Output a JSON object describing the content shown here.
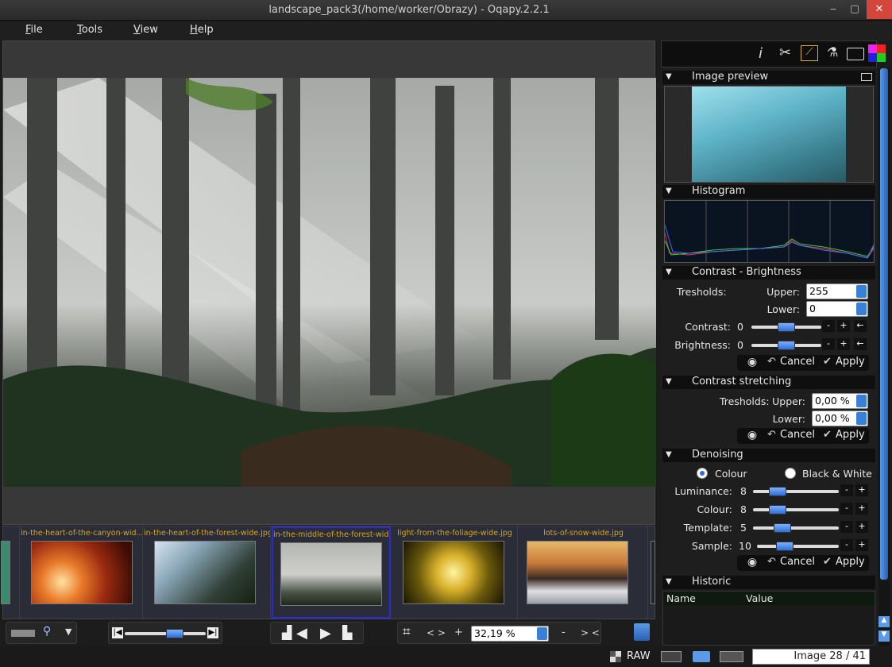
{
  "window": {
    "title": "landscape_pack3(/home/worker/Obrazy) - Oqapy.2.2.1",
    "min": "‒",
    "max": "▢",
    "close": "✕"
  },
  "menu": [
    "File",
    "Tools",
    "View",
    "Help"
  ],
  "thumbnails": [
    {
      "label": "in-the-heart-of-the-canyon-wid..."
    },
    {
      "label": "in-the-heart-of-the-forest-wide.jpg"
    },
    {
      "label": "in-the-middle-of-the-forest-wid..."
    },
    {
      "label": "light-from-the-foliage-wide.jpg"
    },
    {
      "label": "lots-of-snow-wide.jpg"
    }
  ],
  "zoom": {
    "value": "32,19 %",
    "fit_label": "< >",
    "plus": "+",
    "minus": "-",
    "fill_label": "> <"
  },
  "status": {
    "raw": "RAW",
    "counter": "Image 28 / 41"
  },
  "panel": {
    "image_preview": {
      "title": "Image preview"
    },
    "histogram": {
      "title": "Histogram"
    },
    "contrast_brightness": {
      "title": "Contrast - Brightness",
      "tresholds_label": "Tresholds:",
      "upper_label": "Upper:",
      "upper_value": "255",
      "lower_label": "Lower:",
      "lower_value": "0",
      "contrast_label": "Contrast:",
      "contrast_value": "0",
      "brightness_label": "Brightness:",
      "brightness_value": "0",
      "minus": "-",
      "plus": "+",
      "reset": "←",
      "cancel": "Cancel",
      "apply": "Apply"
    },
    "contrast_stretching": {
      "title": "Contrast stretching",
      "tresholds_label": "Tresholds:",
      "upper_label": "Upper:",
      "upper_value": "0,00 %",
      "lower_label": "Lower:",
      "lower_value": "0,00 %",
      "cancel": "Cancel",
      "apply": "Apply"
    },
    "denoising": {
      "title": "Denoising",
      "colour_radio": "Colour",
      "bw_radio": "Black & White",
      "luminance_label": "Luminance:",
      "luminance_value": "8",
      "colour_label": "Colour:",
      "colour_value": "8",
      "template_label": "Template:",
      "template_value": "5",
      "sample_label": "Sample:",
      "sample_value": "10",
      "minus": "-",
      "plus": "+",
      "cancel": "Cancel",
      "apply": "Apply"
    },
    "historic": {
      "title": "Historic",
      "col_name": "Name",
      "col_value": "Value"
    }
  },
  "icons": {
    "info": "info-icon",
    "cut": "scissors-icon",
    "levels": "levels-icon",
    "flask": "flask-icon",
    "folder": "folder-icon",
    "color": "color-grid-icon"
  }
}
